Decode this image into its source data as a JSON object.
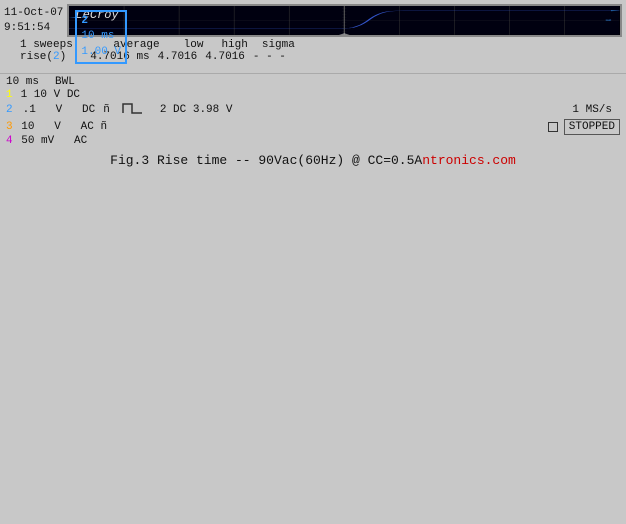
{
  "timestamp": {
    "date": "11-Oct-07",
    "time": "9:51:54"
  },
  "channel_box": {
    "line1": "2",
    "line2": "10 ms",
    "line3": "1.00 V"
  },
  "brand": "LeCroy",
  "measurement": {
    "sweeps": "1 sweeps:",
    "col_average": "average",
    "col_low": "low",
    "col_high": "high",
    "col_sigma": "sigma",
    "row_label": "rise(2)",
    "val_average": "4.7016 ms",
    "val_low": "4.7016",
    "val_high": "4.7016",
    "val_sigma": "- - -"
  },
  "bottom": {
    "timebase": "10 ms",
    "bwl": "BWL",
    "ch1": "1  10   V   DC",
    "ch2_line1": "2  .1   V   DC",
    "ch2_dc": "ñ",
    "ch3": "3 10   V   AC",
    "ch3_ac": "ñ",
    "ch4": "4  50 mV   AC",
    "sample_rate": "1 MS/s",
    "ch2_probe": "2 DC 3.98 V",
    "stopped": "STOPPED"
  },
  "caption": {
    "text": "Fig.3  Rise time  --  90Vac(60Hz) @  CC=0.5A",
    "suffix": "ntronics.com"
  }
}
